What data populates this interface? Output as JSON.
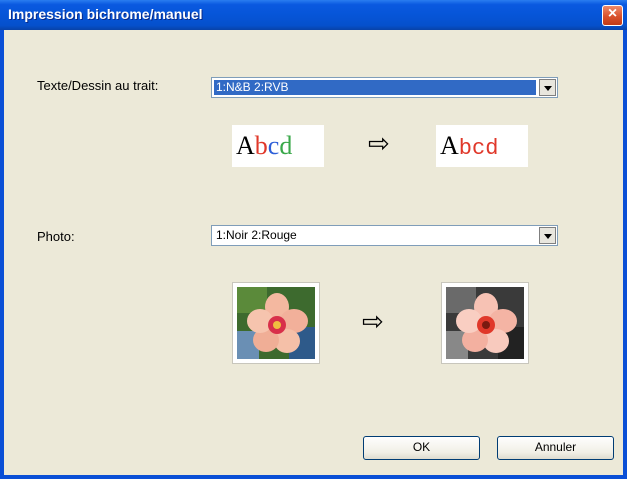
{
  "window": {
    "title": "Impression bichrome/manuel"
  },
  "text_section": {
    "label": "Texte/Dessin au trait:",
    "select_value": "1:N&B 2:RVB",
    "sample_before": [
      "A",
      "b",
      "c",
      "d"
    ],
    "sample_after": [
      "A",
      "b",
      "c",
      "d"
    ],
    "arrow": "⇨"
  },
  "photo_section": {
    "label": "Photo:",
    "select_value": "1:Noir 2:Rouge",
    "arrow": "⇨"
  },
  "buttons": {
    "ok": "OK",
    "cancel": "Annuler"
  },
  "colors": {
    "title_bar": "#0a59e0",
    "selection": "#316ac5",
    "bg": "#ece9d8",
    "accent_red": "#e0382a"
  }
}
